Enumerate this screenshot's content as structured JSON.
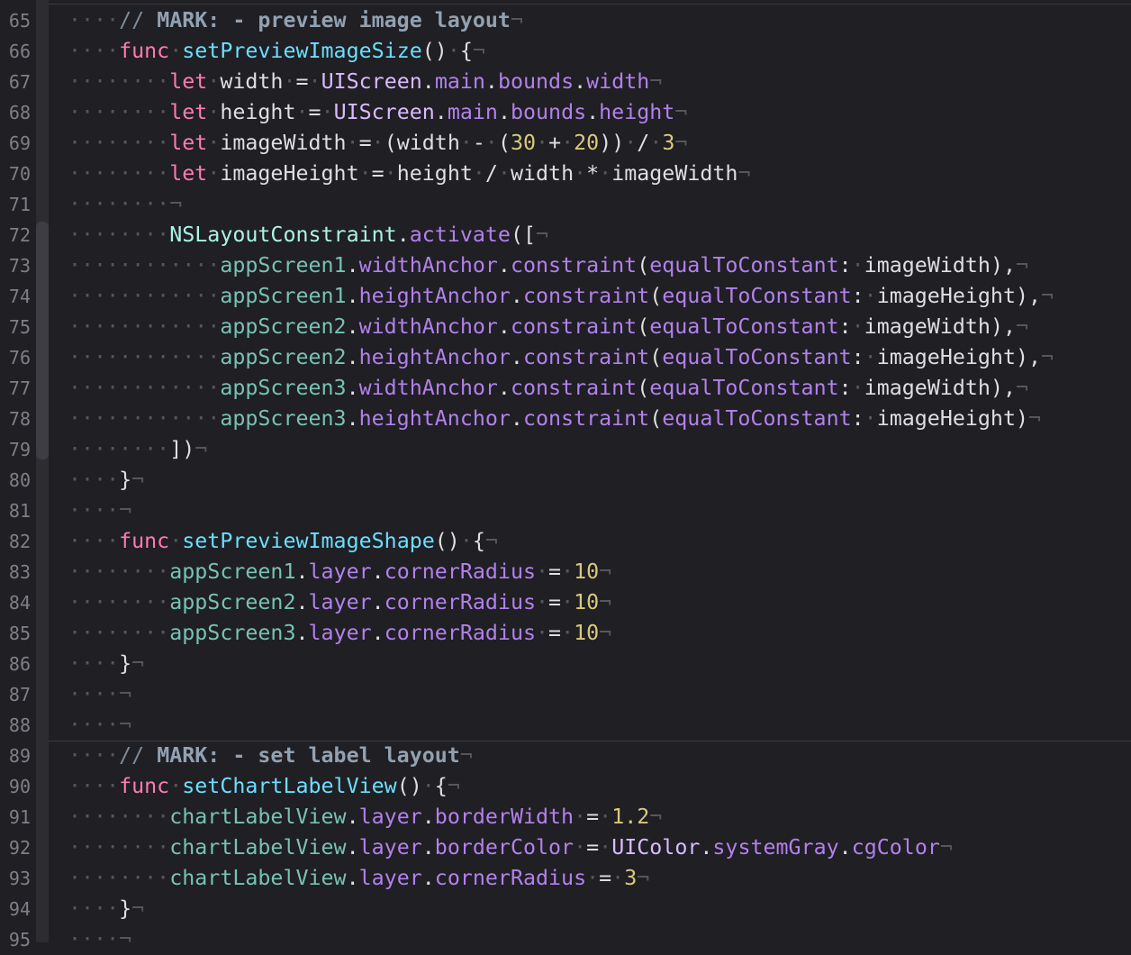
{
  "editor": {
    "lines": [
      {
        "no": "65",
        "segs": [
          [
            "ws",
            "····"
          ],
          [
            "com",
            "// "
          ],
          [
            "mark",
            "MARK: - preview image layout"
          ],
          [
            "nl",
            "¬"
          ]
        ]
      },
      {
        "no": "66",
        "segs": [
          [
            "ws",
            "····"
          ],
          [
            "kw",
            "func"
          ],
          [
            "ws",
            "·"
          ],
          [
            "fn",
            "setPreviewImageSize"
          ],
          [
            "pl",
            "()"
          ],
          [
            "ws",
            "·"
          ],
          [
            "pl",
            "{"
          ],
          [
            "nl",
            "¬"
          ]
        ]
      },
      {
        "no": "67",
        "segs": [
          [
            "ws",
            "········"
          ],
          [
            "kw",
            "let"
          ],
          [
            "ws",
            "·"
          ],
          [
            "pl",
            "width"
          ],
          [
            "ws",
            "·"
          ],
          [
            "pl",
            "="
          ],
          [
            "ws",
            "·"
          ],
          [
            "type",
            "UIScreen"
          ],
          [
            "pl",
            "."
          ],
          [
            "prop",
            "main"
          ],
          [
            "pl",
            "."
          ],
          [
            "prop",
            "bounds"
          ],
          [
            "pl",
            "."
          ],
          [
            "prop",
            "width"
          ],
          [
            "nl",
            "¬"
          ]
        ]
      },
      {
        "no": "68",
        "segs": [
          [
            "ws",
            "········"
          ],
          [
            "kw",
            "let"
          ],
          [
            "ws",
            "·"
          ],
          [
            "pl",
            "height"
          ],
          [
            "ws",
            "·"
          ],
          [
            "pl",
            "="
          ],
          [
            "ws",
            "·"
          ],
          [
            "type",
            "UIScreen"
          ],
          [
            "pl",
            "."
          ],
          [
            "prop",
            "main"
          ],
          [
            "pl",
            "."
          ],
          [
            "prop",
            "bounds"
          ],
          [
            "pl",
            "."
          ],
          [
            "prop",
            "height"
          ],
          [
            "nl",
            "¬"
          ]
        ]
      },
      {
        "no": "69",
        "segs": [
          [
            "ws",
            "········"
          ],
          [
            "kw",
            "let"
          ],
          [
            "ws",
            "·"
          ],
          [
            "pl",
            "imageWidth"
          ],
          [
            "ws",
            "·"
          ],
          [
            "pl",
            "="
          ],
          [
            "ws",
            "·"
          ],
          [
            "pl",
            "(width"
          ],
          [
            "ws",
            "·"
          ],
          [
            "pl",
            "-"
          ],
          [
            "ws",
            "·"
          ],
          [
            "pl",
            "("
          ],
          [
            "num",
            "30"
          ],
          [
            "ws",
            "·"
          ],
          [
            "pl",
            "+"
          ],
          [
            "ws",
            "·"
          ],
          [
            "num",
            "20"
          ],
          [
            "pl",
            "))"
          ],
          [
            "ws",
            "·"
          ],
          [
            "pl",
            "/"
          ],
          [
            "ws",
            "·"
          ],
          [
            "num",
            "3"
          ],
          [
            "nl",
            "¬"
          ]
        ]
      },
      {
        "no": "70",
        "segs": [
          [
            "ws",
            "········"
          ],
          [
            "kw",
            "let"
          ],
          [
            "ws",
            "·"
          ],
          [
            "pl",
            "imageHeight"
          ],
          [
            "ws",
            "·"
          ],
          [
            "pl",
            "="
          ],
          [
            "ws",
            "·"
          ],
          [
            "pl",
            "height"
          ],
          [
            "ws",
            "·"
          ],
          [
            "pl",
            "/"
          ],
          [
            "ws",
            "·"
          ],
          [
            "pl",
            "width"
          ],
          [
            "ws",
            "·"
          ],
          [
            "pl",
            "*"
          ],
          [
            "ws",
            "·"
          ],
          [
            "pl",
            "imageWidth"
          ],
          [
            "nl",
            "¬"
          ]
        ]
      },
      {
        "no": "71",
        "segs": [
          [
            "ws",
            "········"
          ],
          [
            "nl",
            "¬"
          ]
        ]
      },
      {
        "no": "72",
        "segs": [
          [
            "ws",
            "········"
          ],
          [
            "cls",
            "NSLayoutConstraint"
          ],
          [
            "pl",
            "."
          ],
          [
            "prop",
            "activate"
          ],
          [
            "pl",
            "(["
          ],
          [
            "nl",
            "¬"
          ]
        ]
      },
      {
        "no": "73",
        "segs": [
          [
            "ws",
            "············"
          ],
          [
            "var",
            "appScreen1"
          ],
          [
            "pl",
            "."
          ],
          [
            "prop",
            "widthAnchor"
          ],
          [
            "pl",
            "."
          ],
          [
            "prop",
            "constraint"
          ],
          [
            "pl",
            "("
          ],
          [
            "prop",
            "equalToConstant"
          ],
          [
            "pl",
            ":"
          ],
          [
            "ws",
            "·"
          ],
          [
            "pl",
            "imageWidth),"
          ],
          [
            "nl",
            "¬"
          ]
        ]
      },
      {
        "no": "74",
        "segs": [
          [
            "ws",
            "············"
          ],
          [
            "var",
            "appScreen1"
          ],
          [
            "pl",
            "."
          ],
          [
            "prop",
            "heightAnchor"
          ],
          [
            "pl",
            "."
          ],
          [
            "prop",
            "constraint"
          ],
          [
            "pl",
            "("
          ],
          [
            "prop",
            "equalToConstant"
          ],
          [
            "pl",
            ":"
          ],
          [
            "ws",
            "·"
          ],
          [
            "pl",
            "imageHeight),"
          ],
          [
            "nl",
            "¬"
          ]
        ]
      },
      {
        "no": "75",
        "segs": [
          [
            "ws",
            "············"
          ],
          [
            "var",
            "appScreen2"
          ],
          [
            "pl",
            "."
          ],
          [
            "prop",
            "widthAnchor"
          ],
          [
            "pl",
            "."
          ],
          [
            "prop",
            "constraint"
          ],
          [
            "pl",
            "("
          ],
          [
            "prop",
            "equalToConstant"
          ],
          [
            "pl",
            ":"
          ],
          [
            "ws",
            "·"
          ],
          [
            "pl",
            "imageWidth),"
          ],
          [
            "nl",
            "¬"
          ]
        ]
      },
      {
        "no": "76",
        "segs": [
          [
            "ws",
            "············"
          ],
          [
            "var",
            "appScreen2"
          ],
          [
            "pl",
            "."
          ],
          [
            "prop",
            "heightAnchor"
          ],
          [
            "pl",
            "."
          ],
          [
            "prop",
            "constraint"
          ],
          [
            "pl",
            "("
          ],
          [
            "prop",
            "equalToConstant"
          ],
          [
            "pl",
            ":"
          ],
          [
            "ws",
            "·"
          ],
          [
            "pl",
            "imageHeight),"
          ],
          [
            "nl",
            "¬"
          ]
        ]
      },
      {
        "no": "77",
        "segs": [
          [
            "ws",
            "············"
          ],
          [
            "var",
            "appScreen3"
          ],
          [
            "pl",
            "."
          ],
          [
            "prop",
            "widthAnchor"
          ],
          [
            "pl",
            "."
          ],
          [
            "prop",
            "constraint"
          ],
          [
            "pl",
            "("
          ],
          [
            "prop",
            "equalToConstant"
          ],
          [
            "pl",
            ":"
          ],
          [
            "ws",
            "·"
          ],
          [
            "pl",
            "imageWidth),"
          ],
          [
            "nl",
            "¬"
          ]
        ]
      },
      {
        "no": "78",
        "segs": [
          [
            "ws",
            "············"
          ],
          [
            "var",
            "appScreen3"
          ],
          [
            "pl",
            "."
          ],
          [
            "prop",
            "heightAnchor"
          ],
          [
            "pl",
            "."
          ],
          [
            "prop",
            "constraint"
          ],
          [
            "pl",
            "("
          ],
          [
            "prop",
            "equalToConstant"
          ],
          [
            "pl",
            ":"
          ],
          [
            "ws",
            "·"
          ],
          [
            "pl",
            "imageHeight)"
          ],
          [
            "nl",
            "¬"
          ]
        ]
      },
      {
        "no": "79",
        "segs": [
          [
            "ws",
            "········"
          ],
          [
            "pl",
            "])"
          ],
          [
            "nl",
            "¬"
          ]
        ]
      },
      {
        "no": "80",
        "segs": [
          [
            "ws",
            "····"
          ],
          [
            "pl",
            "}"
          ],
          [
            "nl",
            "¬"
          ]
        ]
      },
      {
        "no": "81",
        "segs": [
          [
            "ws",
            "····"
          ],
          [
            "nl",
            "¬"
          ]
        ]
      },
      {
        "no": "82",
        "segs": [
          [
            "ws",
            "····"
          ],
          [
            "kw",
            "func"
          ],
          [
            "ws",
            "·"
          ],
          [
            "fn",
            "setPreviewImageShape"
          ],
          [
            "pl",
            "()"
          ],
          [
            "ws",
            "·"
          ],
          [
            "pl",
            "{"
          ],
          [
            "nl",
            "¬"
          ]
        ]
      },
      {
        "no": "83",
        "segs": [
          [
            "ws",
            "········"
          ],
          [
            "var",
            "appScreen1"
          ],
          [
            "pl",
            "."
          ],
          [
            "prop",
            "layer"
          ],
          [
            "pl",
            "."
          ],
          [
            "prop",
            "cornerRadius"
          ],
          [
            "ws",
            "·"
          ],
          [
            "pl",
            "="
          ],
          [
            "ws",
            "·"
          ],
          [
            "num",
            "10"
          ],
          [
            "nl",
            "¬"
          ]
        ]
      },
      {
        "no": "84",
        "segs": [
          [
            "ws",
            "········"
          ],
          [
            "var",
            "appScreen2"
          ],
          [
            "pl",
            "."
          ],
          [
            "prop",
            "layer"
          ],
          [
            "pl",
            "."
          ],
          [
            "prop",
            "cornerRadius"
          ],
          [
            "ws",
            "·"
          ],
          [
            "pl",
            "="
          ],
          [
            "ws",
            "·"
          ],
          [
            "num",
            "10"
          ],
          [
            "nl",
            "¬"
          ]
        ]
      },
      {
        "no": "85",
        "segs": [
          [
            "ws",
            "········"
          ],
          [
            "var",
            "appScreen3"
          ],
          [
            "pl",
            "."
          ],
          [
            "prop",
            "layer"
          ],
          [
            "pl",
            "."
          ],
          [
            "prop",
            "cornerRadius"
          ],
          [
            "ws",
            "·"
          ],
          [
            "pl",
            "="
          ],
          [
            "ws",
            "·"
          ],
          [
            "num",
            "10"
          ],
          [
            "nl",
            "¬"
          ]
        ]
      },
      {
        "no": "86",
        "segs": [
          [
            "ws",
            "····"
          ],
          [
            "pl",
            "}"
          ],
          [
            "nl",
            "¬"
          ]
        ]
      },
      {
        "no": "87",
        "segs": [
          [
            "ws",
            "····"
          ],
          [
            "nl",
            "¬"
          ]
        ]
      },
      {
        "no": "88",
        "segs": [
          [
            "ws",
            "····"
          ],
          [
            "nl",
            "¬"
          ]
        ]
      },
      {
        "no": "89",
        "segs": [
          [
            "ws",
            "····"
          ],
          [
            "com",
            "// "
          ],
          [
            "mark",
            "MARK: - set label layout"
          ],
          [
            "nl",
            "¬"
          ]
        ]
      },
      {
        "no": "90",
        "segs": [
          [
            "ws",
            "····"
          ],
          [
            "kw",
            "func"
          ],
          [
            "ws",
            "·"
          ],
          [
            "fn",
            "setChartLabelView"
          ],
          [
            "pl",
            "()"
          ],
          [
            "ws",
            "·"
          ],
          [
            "pl",
            "{"
          ],
          [
            "nl",
            "¬"
          ]
        ]
      },
      {
        "no": "91",
        "segs": [
          [
            "ws",
            "········"
          ],
          [
            "var",
            "chartLabelView"
          ],
          [
            "pl",
            "."
          ],
          [
            "prop",
            "layer"
          ],
          [
            "pl",
            "."
          ],
          [
            "prop",
            "borderWidth"
          ],
          [
            "ws",
            "·"
          ],
          [
            "pl",
            "="
          ],
          [
            "ws",
            "·"
          ],
          [
            "num",
            "1.2"
          ],
          [
            "nl",
            "¬"
          ]
        ]
      },
      {
        "no": "92",
        "segs": [
          [
            "ws",
            "········"
          ],
          [
            "var",
            "chartLabelView"
          ],
          [
            "pl",
            "."
          ],
          [
            "prop",
            "layer"
          ],
          [
            "pl",
            "."
          ],
          [
            "prop",
            "borderColor"
          ],
          [
            "ws",
            "·"
          ],
          [
            "pl",
            "="
          ],
          [
            "ws",
            "·"
          ],
          [
            "type",
            "UIColor"
          ],
          [
            "pl",
            "."
          ],
          [
            "prop",
            "systemGray"
          ],
          [
            "pl",
            "."
          ],
          [
            "prop",
            "cgColor"
          ],
          [
            "nl",
            "¬"
          ]
        ]
      },
      {
        "no": "93",
        "segs": [
          [
            "ws",
            "········"
          ],
          [
            "var",
            "chartLabelView"
          ],
          [
            "pl",
            "."
          ],
          [
            "prop",
            "layer"
          ],
          [
            "pl",
            "."
          ],
          [
            "prop",
            "cornerRadius"
          ],
          [
            "ws",
            "·"
          ],
          [
            "pl",
            "="
          ],
          [
            "ws",
            "·"
          ],
          [
            "num",
            "3"
          ],
          [
            "nl",
            "¬"
          ]
        ]
      },
      {
        "no": "94",
        "segs": [
          [
            "ws",
            "····"
          ],
          [
            "pl",
            "}"
          ],
          [
            "nl",
            "¬"
          ]
        ]
      },
      {
        "no": "95",
        "segs": [
          [
            "ws",
            "····"
          ],
          [
            "nl",
            "¬"
          ]
        ]
      }
    ]
  }
}
